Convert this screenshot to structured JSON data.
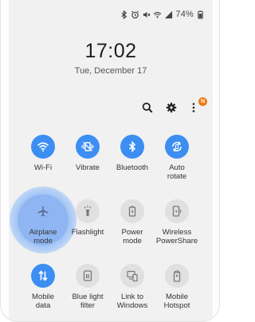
{
  "status_bar": {
    "battery": "74%",
    "icons": [
      "bluetooth-icon",
      "alarm-icon",
      "mute-icon",
      "wifi-icon",
      "signal-icon",
      "battery-icon"
    ]
  },
  "lock": {
    "time": "17:02",
    "date": "Tue, December 17"
  },
  "actions": {
    "notification_badge": "N",
    "items": [
      "search-icon",
      "settings-gear-icon",
      "more-options-icon"
    ]
  },
  "colors": {
    "accent": "#3c8ef2",
    "tile_off": "#e0e0e0",
    "badge": "#f07a18"
  },
  "tiles": [
    {
      "label": "Wi-Fi",
      "icon": "wifi-icon",
      "state": "on"
    },
    {
      "label": "Vibrate",
      "icon": "vibrate-icon",
      "state": "on"
    },
    {
      "label": "Bluetooth",
      "icon": "bluetooth-icon",
      "state": "on"
    },
    {
      "label": "Auto\nrotate",
      "icon": "rotate-icon",
      "state": "on"
    },
    {
      "label": "Airplane\nmode",
      "icon": "airplane-icon",
      "state": "pressed"
    },
    {
      "label": "Flashlight",
      "icon": "flashlight-icon",
      "state": "off"
    },
    {
      "label": "Power\nmode",
      "icon": "power-mode-icon",
      "state": "off"
    },
    {
      "label": "Wireless\nPowerShare",
      "icon": "wireless-powershare-icon",
      "state": "off"
    },
    {
      "label": "Mobile\ndata",
      "icon": "mobile-data-icon",
      "state": "on"
    },
    {
      "label": "Blue light\nfilter",
      "icon": "blue-light-filter-icon",
      "state": "off"
    },
    {
      "label": "Link to\nWindows",
      "icon": "link-to-windows-icon",
      "state": "off"
    },
    {
      "label": "Mobile\nHotspot",
      "icon": "mobile-hotspot-icon",
      "state": "off"
    }
  ]
}
